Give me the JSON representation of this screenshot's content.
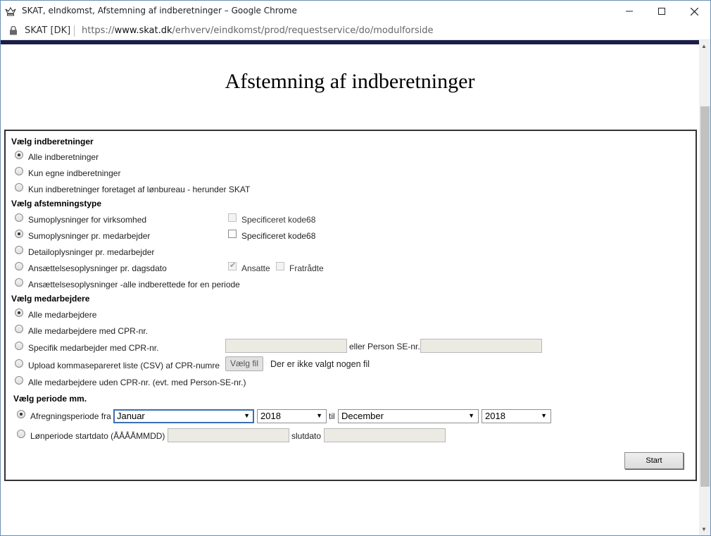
{
  "window": {
    "title": "SKAT, eIndkomst, Afstemning af indberetninger – Google Chrome",
    "site_label": "SKAT [DK]",
    "url_prefix": "https://",
    "url_host": "www.skat.dk",
    "url_path": "/erhverv/eindkomst/prod/requestservice/do/modulforside"
  },
  "page": {
    "title": "Afstemning af indberetninger"
  },
  "sections": {
    "indberetninger": {
      "header": "Vælg indberetninger",
      "options": [
        "Alle indberetninger",
        "Kun egne indberetninger",
        "Kun indberetninger foretaget af lønbureau - herunder SKAT"
      ],
      "selected": "Alle indberetninger"
    },
    "afstemningstype": {
      "header": "Vælg afstemningstype",
      "options": [
        "Sumoplysninger for virksomhed",
        "Sumoplysninger pr. medarbejder",
        "Detailoplysninger pr. medarbejder",
        "Ansættelsesoplysninger pr. dagsdato",
        "Ansættelsesoplysninger -alle indberettede for en periode"
      ],
      "selected": "Sumoplysninger pr. medarbejder",
      "checkbox_specificeret_1": "Specificeret kode68",
      "checkbox_specificeret_2": "Specificeret kode68",
      "checkbox_ansatte": "Ansatte",
      "checkbox_fratraadte": "Fratrådte"
    },
    "medarbejdere": {
      "header": "Vælg medarbejdere",
      "options": [
        "Alle medarbejdere",
        "Alle medarbejdere med CPR-nr.",
        "Specifik medarbejder med CPR-nr.",
        "Upload kommasepareret liste (CSV) af CPR-numre",
        "Alle medarbejdere uden CPR-nr. (evt. med Person-SE-nr.)"
      ],
      "selected": "Alle medarbejdere",
      "person_se_label": "eller Person SE-nr.",
      "file_button": "Vælg fil",
      "file_status": "Der er ikke valgt nogen fil"
    },
    "periode": {
      "header": "Vælg periode mm.",
      "afregning_label": "Afregningsperiode fra",
      "from_month": "Januar",
      "from_year": "2018",
      "til_label": "til",
      "to_month": "December",
      "to_year": "2018",
      "loenperiode_label": "Lønperiode startdato (ÅÅÅÅMMDD)",
      "slutdato_label": "slutdato",
      "selected": "Afregningsperiode fra"
    }
  },
  "actions": {
    "start_label": "Start"
  }
}
